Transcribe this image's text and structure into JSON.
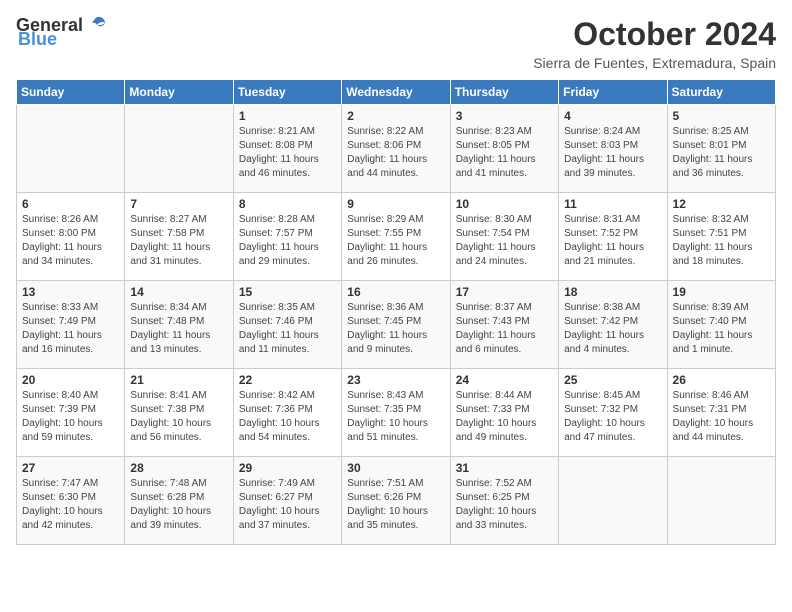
{
  "header": {
    "logo_general": "General",
    "logo_blue": "Blue",
    "month_title": "October 2024",
    "location": "Sierra de Fuentes, Extremadura, Spain"
  },
  "weekdays": [
    "Sunday",
    "Monday",
    "Tuesday",
    "Wednesday",
    "Thursday",
    "Friday",
    "Saturday"
  ],
  "weeks": [
    [
      {
        "day": "",
        "sunrise": "",
        "sunset": "",
        "daylight": ""
      },
      {
        "day": "",
        "sunrise": "",
        "sunset": "",
        "daylight": ""
      },
      {
        "day": "1",
        "sunrise": "Sunrise: 8:21 AM",
        "sunset": "Sunset: 8:08 PM",
        "daylight": "Daylight: 11 hours and 46 minutes."
      },
      {
        "day": "2",
        "sunrise": "Sunrise: 8:22 AM",
        "sunset": "Sunset: 8:06 PM",
        "daylight": "Daylight: 11 hours and 44 minutes."
      },
      {
        "day": "3",
        "sunrise": "Sunrise: 8:23 AM",
        "sunset": "Sunset: 8:05 PM",
        "daylight": "Daylight: 11 hours and 41 minutes."
      },
      {
        "day": "4",
        "sunrise": "Sunrise: 8:24 AM",
        "sunset": "Sunset: 8:03 PM",
        "daylight": "Daylight: 11 hours and 39 minutes."
      },
      {
        "day": "5",
        "sunrise": "Sunrise: 8:25 AM",
        "sunset": "Sunset: 8:01 PM",
        "daylight": "Daylight: 11 hours and 36 minutes."
      }
    ],
    [
      {
        "day": "6",
        "sunrise": "Sunrise: 8:26 AM",
        "sunset": "Sunset: 8:00 PM",
        "daylight": "Daylight: 11 hours and 34 minutes."
      },
      {
        "day": "7",
        "sunrise": "Sunrise: 8:27 AM",
        "sunset": "Sunset: 7:58 PM",
        "daylight": "Daylight: 11 hours and 31 minutes."
      },
      {
        "day": "8",
        "sunrise": "Sunrise: 8:28 AM",
        "sunset": "Sunset: 7:57 PM",
        "daylight": "Daylight: 11 hours and 29 minutes."
      },
      {
        "day": "9",
        "sunrise": "Sunrise: 8:29 AM",
        "sunset": "Sunset: 7:55 PM",
        "daylight": "Daylight: 11 hours and 26 minutes."
      },
      {
        "day": "10",
        "sunrise": "Sunrise: 8:30 AM",
        "sunset": "Sunset: 7:54 PM",
        "daylight": "Daylight: 11 hours and 24 minutes."
      },
      {
        "day": "11",
        "sunrise": "Sunrise: 8:31 AM",
        "sunset": "Sunset: 7:52 PM",
        "daylight": "Daylight: 11 hours and 21 minutes."
      },
      {
        "day": "12",
        "sunrise": "Sunrise: 8:32 AM",
        "sunset": "Sunset: 7:51 PM",
        "daylight": "Daylight: 11 hours and 18 minutes."
      }
    ],
    [
      {
        "day": "13",
        "sunrise": "Sunrise: 8:33 AM",
        "sunset": "Sunset: 7:49 PM",
        "daylight": "Daylight: 11 hours and 16 minutes."
      },
      {
        "day": "14",
        "sunrise": "Sunrise: 8:34 AM",
        "sunset": "Sunset: 7:48 PM",
        "daylight": "Daylight: 11 hours and 13 minutes."
      },
      {
        "day": "15",
        "sunrise": "Sunrise: 8:35 AM",
        "sunset": "Sunset: 7:46 PM",
        "daylight": "Daylight: 11 hours and 11 minutes."
      },
      {
        "day": "16",
        "sunrise": "Sunrise: 8:36 AM",
        "sunset": "Sunset: 7:45 PM",
        "daylight": "Daylight: 11 hours and 9 minutes."
      },
      {
        "day": "17",
        "sunrise": "Sunrise: 8:37 AM",
        "sunset": "Sunset: 7:43 PM",
        "daylight": "Daylight: 11 hours and 6 minutes."
      },
      {
        "day": "18",
        "sunrise": "Sunrise: 8:38 AM",
        "sunset": "Sunset: 7:42 PM",
        "daylight": "Daylight: 11 hours and 4 minutes."
      },
      {
        "day": "19",
        "sunrise": "Sunrise: 8:39 AM",
        "sunset": "Sunset: 7:40 PM",
        "daylight": "Daylight: 11 hours and 1 minute."
      }
    ],
    [
      {
        "day": "20",
        "sunrise": "Sunrise: 8:40 AM",
        "sunset": "Sunset: 7:39 PM",
        "daylight": "Daylight: 10 hours and 59 minutes."
      },
      {
        "day": "21",
        "sunrise": "Sunrise: 8:41 AM",
        "sunset": "Sunset: 7:38 PM",
        "daylight": "Daylight: 10 hours and 56 minutes."
      },
      {
        "day": "22",
        "sunrise": "Sunrise: 8:42 AM",
        "sunset": "Sunset: 7:36 PM",
        "daylight": "Daylight: 10 hours and 54 minutes."
      },
      {
        "day": "23",
        "sunrise": "Sunrise: 8:43 AM",
        "sunset": "Sunset: 7:35 PM",
        "daylight": "Daylight: 10 hours and 51 minutes."
      },
      {
        "day": "24",
        "sunrise": "Sunrise: 8:44 AM",
        "sunset": "Sunset: 7:33 PM",
        "daylight": "Daylight: 10 hours and 49 minutes."
      },
      {
        "day": "25",
        "sunrise": "Sunrise: 8:45 AM",
        "sunset": "Sunset: 7:32 PM",
        "daylight": "Daylight: 10 hours and 47 minutes."
      },
      {
        "day": "26",
        "sunrise": "Sunrise: 8:46 AM",
        "sunset": "Sunset: 7:31 PM",
        "daylight": "Daylight: 10 hours and 44 minutes."
      }
    ],
    [
      {
        "day": "27",
        "sunrise": "Sunrise: 7:47 AM",
        "sunset": "Sunset: 6:30 PM",
        "daylight": "Daylight: 10 hours and 42 minutes."
      },
      {
        "day": "28",
        "sunrise": "Sunrise: 7:48 AM",
        "sunset": "Sunset: 6:28 PM",
        "daylight": "Daylight: 10 hours and 39 minutes."
      },
      {
        "day": "29",
        "sunrise": "Sunrise: 7:49 AM",
        "sunset": "Sunset: 6:27 PM",
        "daylight": "Daylight: 10 hours and 37 minutes."
      },
      {
        "day": "30",
        "sunrise": "Sunrise: 7:51 AM",
        "sunset": "Sunset: 6:26 PM",
        "daylight": "Daylight: 10 hours and 35 minutes."
      },
      {
        "day": "31",
        "sunrise": "Sunrise: 7:52 AM",
        "sunset": "Sunset: 6:25 PM",
        "daylight": "Daylight: 10 hours and 33 minutes."
      },
      {
        "day": "",
        "sunrise": "",
        "sunset": "",
        "daylight": ""
      },
      {
        "day": "",
        "sunrise": "",
        "sunset": "",
        "daylight": ""
      }
    ]
  ]
}
